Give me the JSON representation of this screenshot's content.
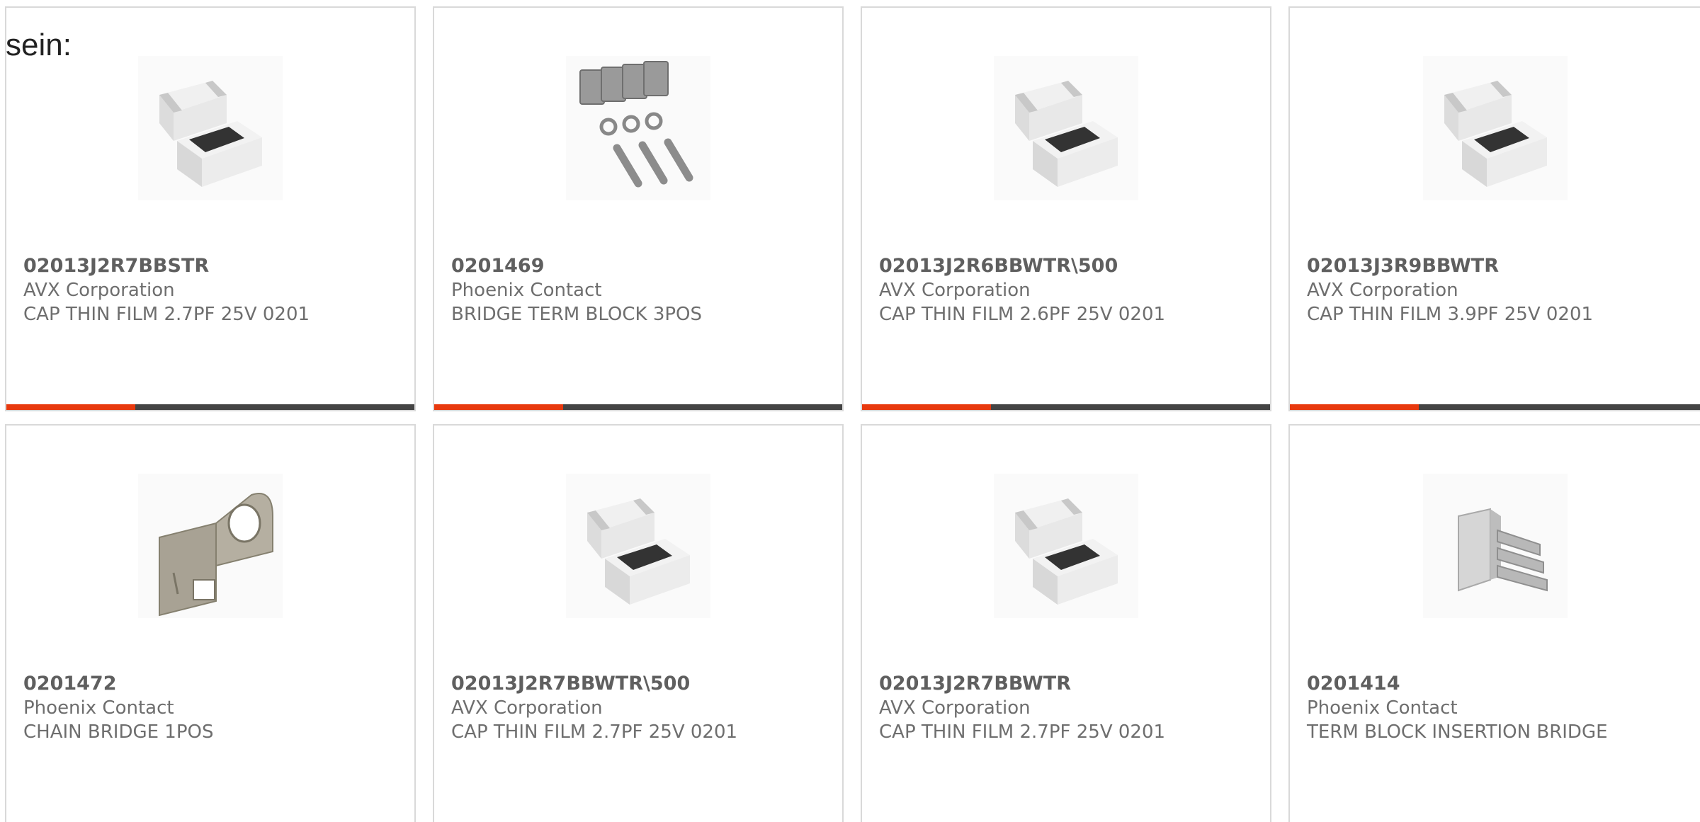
{
  "lead_text": "sein:",
  "colors": {
    "accent": "#e8390e",
    "bar": "#444444",
    "card_border": "#d9d9d9",
    "text": "#666666"
  },
  "products": [
    {
      "part": "02013J2R7BBSTR",
      "maker": "AVX Corporation",
      "desc": "CAP THIN FILM 2.7PF 25V 0201",
      "icon": "chip-capacitor-image"
    },
    {
      "part": "0201469",
      "maker": "Phoenix Contact",
      "desc": "BRIDGE TERM BLOCK 3POS",
      "icon": "bridge-screws-image"
    },
    {
      "part": "02013J2R6BBWTR\\500",
      "maker": "AVX Corporation",
      "desc": "CAP THIN FILM 2.6PF 25V 0201",
      "icon": "chip-capacitor-image"
    },
    {
      "part": "02013J3R9BBWTR",
      "maker": "AVX Corporation",
      "desc": "CAP THIN FILM 3.9PF 25V 0201",
      "icon": "chip-capacitor-image"
    },
    {
      "part": "0201472",
      "maker": "Phoenix Contact",
      "desc": "CHAIN BRIDGE 1POS",
      "icon": "chain-bridge-image"
    },
    {
      "part": "02013J2R7BBWTR\\500",
      "maker": "AVX Corporation",
      "desc": "CAP THIN FILM 2.7PF 25V 0201",
      "icon": "chip-capacitor-image"
    },
    {
      "part": "02013J2R7BBWTR",
      "maker": "AVX Corporation",
      "desc": "CAP THIN FILM 2.7PF 25V 0201",
      "icon": "chip-capacitor-image"
    },
    {
      "part": "0201414",
      "maker": "Phoenix Contact",
      "desc": "TERM BLOCK INSERTION BRIDGE",
      "icon": "insertion-bridge-image"
    }
  ]
}
